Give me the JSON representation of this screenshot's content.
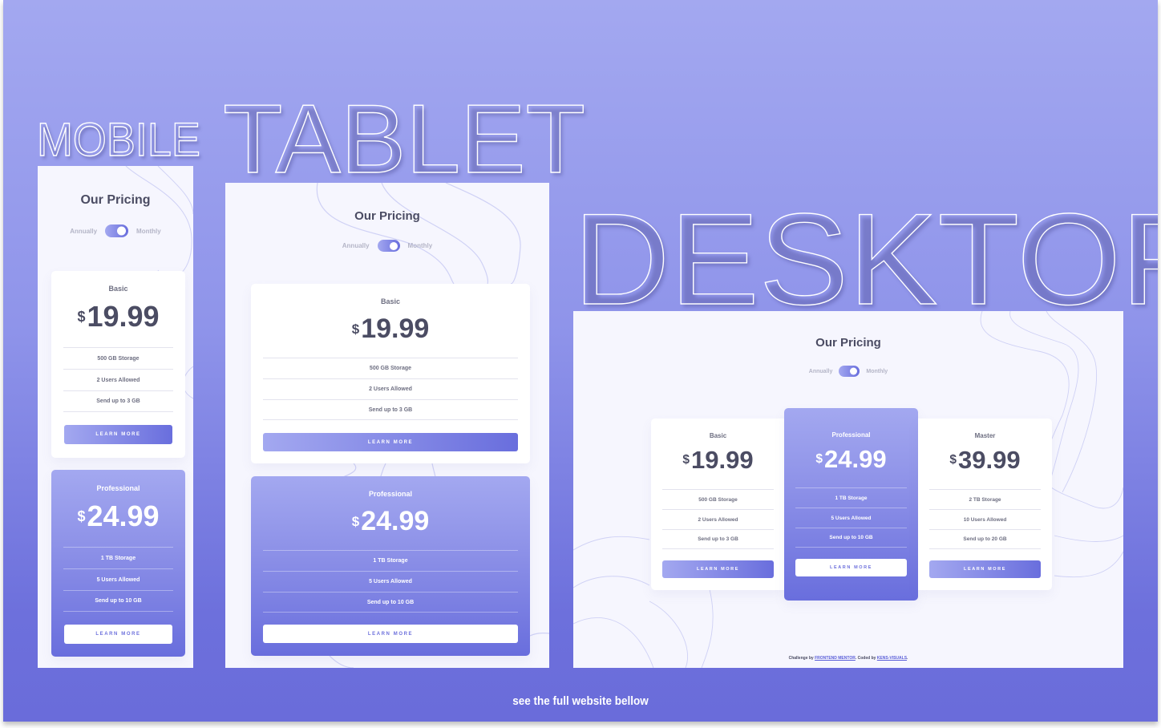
{
  "labels": {
    "mobile": "MOBILE",
    "tablet": "TABLET",
    "desktop": "DESKTOP"
  },
  "pricing": {
    "title": "Our Pricing",
    "toggle": {
      "left_label": "Annually",
      "right_label": "Monthly",
      "state": "monthly"
    },
    "currency_symbol": "$",
    "plans": [
      {
        "name": "Basic",
        "price": "19.99",
        "features": [
          "500 GB Storage",
          "2 Users Allowed",
          "Send up to 3 GB"
        ],
        "button": "LEARN MORE",
        "featured": false
      },
      {
        "name": "Professional",
        "price": "24.99",
        "features": [
          "1 TB Storage",
          "5 Users Allowed",
          "Send up to 10 GB"
        ],
        "button": "LEARN MORE",
        "featured": true
      },
      {
        "name": "Master",
        "price": "39.99",
        "features": [
          "2 TB Storage",
          "10 Users Allowed",
          "Send up to 20 GB"
        ],
        "button": "LEARN MORE",
        "featured": false
      }
    ]
  },
  "footer": {
    "challenge_prefix": "Challenge by",
    "challenge_link": "FRONTEND MENTOR",
    "coded_prefix": ". Coded by",
    "coded_link": "KENS-VISUALS",
    "suffix": "."
  },
  "caption": "see the full website bellow",
  "colors": {
    "accent_light": "#a3a8f0",
    "accent_dark": "#696edd",
    "heading_text": "#4b4c63",
    "frame_bg": "#f6f6fe"
  }
}
